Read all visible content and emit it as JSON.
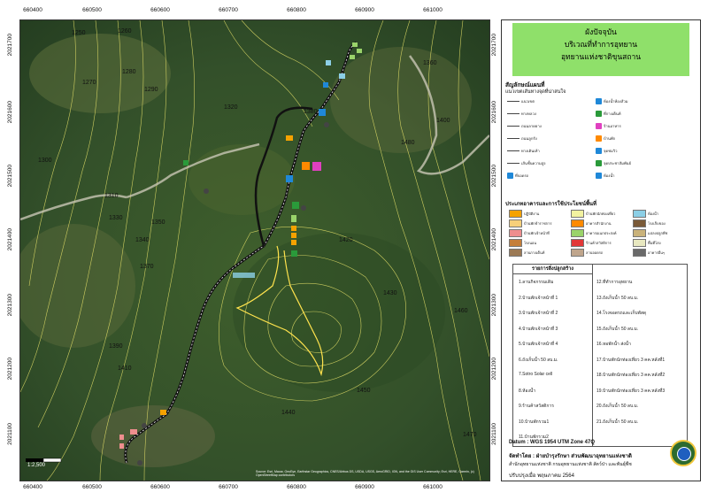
{
  "map": {
    "x_ticks": [
      "660400",
      "660500",
      "660600",
      "660700",
      "660800",
      "660900",
      "661000"
    ],
    "y_ticks": [
      "2021700",
      "2021600",
      "2021500",
      "2021400",
      "2021300",
      "2021200",
      "2021100"
    ],
    "contour_labels": [
      "1250",
      "1260",
      "1270",
      "1280",
      "1290",
      "1300",
      "1310",
      "1320",
      "1330",
      "1340",
      "1350",
      "1360",
      "1370",
      "1380",
      "1390",
      "1400",
      "1410",
      "1420",
      "1430",
      "1440",
      "1450",
      "1460",
      "1470",
      "1480"
    ],
    "scale_label": "1:2,500",
    "attribution": "Source: Esri, Maxar, GeoEye, Earthstar Geographics, CNES/Airbus DS, USDA, USGS, AeroGRID, IGN, and the GIS User Community; Esri, HERE, Garmin, (c) OpenStreetMap contributors",
    "colors": {
      "road": "#1a1a1a",
      "contour": "#e8e36a",
      "trail": "#ffe34d",
      "imagery": "#36512a"
    }
  },
  "legend": {
    "title": "ผังปัจจุบัน\nบริเวณที่ทำการอุทยาน\nอุทยานแห่งชาติขุนสถาน",
    "symbols_heading": "สัญลักษณ์แผนที่",
    "symbols_sub": "แนวเขตเส้นทางจุดที่น่าสนใจ",
    "symbol_rows": [
      {
        "label": "แนวเขต",
        "kind": "line"
      },
      {
        "label": "ทางหลวง",
        "kind": "line"
      },
      {
        "label": "ถนนลาดยาง",
        "kind": "line"
      },
      {
        "label": "ถนนลูกรัง",
        "kind": "line"
      },
      {
        "label": "ทางเดินเท้า",
        "kind": "line"
      },
      {
        "label": "เส้นชั้นความสูง",
        "kind": "line"
      },
      {
        "label": "ที่จอดรถ",
        "kind": "icon"
      },
      {
        "label": "ห้องน้ำห้องส้วม",
        "kind": "icon"
      },
      {
        "label": "ที่กางเต็นท์",
        "kind": "icon"
      },
      {
        "label": "ร้านอาหาร",
        "kind": "icon"
      },
      {
        "label": "บ้านพัก",
        "kind": "icon"
      },
      {
        "label": "จุดชมวิว",
        "kind": "icon"
      },
      {
        "label": "จุดประชาสัมพันธ์",
        "kind": "icon"
      },
      {
        "label": "ห้องน้ำ",
        "kind": "icon"
      }
    ],
    "landuse_heading": "ประเภทอาคารและการใช้ประโยชน์พื้นที่",
    "landuse_rows": [
      {
        "label": "ปฏิบัติงาน",
        "color": "#f5a200"
      },
      {
        "label": "บ้านพักข้าราชการ",
        "color": "#f7d07a"
      },
      {
        "label": "บ้านพักเจ้าหน้าที่",
        "color": "#ee8e8e"
      },
      {
        "label": "โรงนอน",
        "color": "#c57f3a"
      },
      {
        "label": "ลานกางเต็นท์",
        "color": "#9c7a55"
      },
      {
        "label": "บ้านพักนักท่องเที่ยว",
        "color": "#f2f2a0"
      },
      {
        "label": "อาคารสำนักงาน",
        "color": "#ff8a00"
      },
      {
        "label": "อาคารอเนกประสงค์",
        "color": "#9ad36a"
      },
      {
        "label": "ร้านค้าสวัสดิการ",
        "color": "#e23838"
      },
      {
        "label": "ลานจอดรถ",
        "color": "#bfa58c"
      },
      {
        "label": "ห้องน้ำ",
        "color": "#8ccfe6"
      },
      {
        "label": "โรงเก็บของ",
        "color": "#7a5a38"
      },
      {
        "label": "แปลงปลูกพืช",
        "color": "#c9b27a"
      },
      {
        "label": "พื้นที่โล่ง",
        "color": "#e8e8c0"
      },
      {
        "label": "อาคารอื่นๆ",
        "color": "#6a6a6a"
      }
    ],
    "table_heading": "รายการสิ่งปลูกสร้าง",
    "table_left": [
      "1.ลานกิจกรรมเดิม",
      "2.บ้านพักเจ้าหน้าที่ 1",
      "3.บ้านพักเจ้าหน้าที่ 2",
      "4.บ้านพักเจ้าหน้าที่ 3",
      "5.บ้านพักเจ้าหน้าที่ 4",
      "6.ถังเก็บน้ำ 50 ลบ.ม.",
      "7.Sotro Solar cell",
      "8.ห้องน้ำ",
      "9.ร้านค้าสวัสดิการ",
      "10.บ้านพักรวม1",
      "11.บ้านพักรวม2"
    ],
    "table_right": [
      "12.ที่ทำการอุทยาน",
      "13.ถังเก็บน้ำ 50 ลบ.ม.",
      "14.โรงจอดรถและเก็บพัสดุ",
      "15.ถังเก็บน้ำ 50 ลบ.ม.",
      "16.หอพักน้ำ ส่งน้ำ",
      "17.บ้านพักนักท่องเที่ยว 3 คค.หลังที่1",
      "18.บ้านพักนักท่องเที่ยว 3 คค.หลังที่2",
      "19.บ้านพักนักท่องเที่ยว 3 คค.หลังที่3",
      "20.ถังเก็บน้ำ 50 ลบ.ม.",
      "21.ถังเก็บน้ำ 50 ลบ.ม."
    ],
    "datum": "Datum  : WGS 1954 UTM Zone 47Q",
    "made_by": "จัดทำโดย  :  ฝ่ายบำรุงรักษา ส่วนพัฒนาอุทยานแห่งชาติ",
    "org": "สำนักอุทยานแห่งชาติ  กรมอุทยานแห่งชาติ สัตว์ป่า และพันธุ์พืช",
    "updated": "ปรับปรุงเมื่อ  พฤษภาคม 2564"
  }
}
